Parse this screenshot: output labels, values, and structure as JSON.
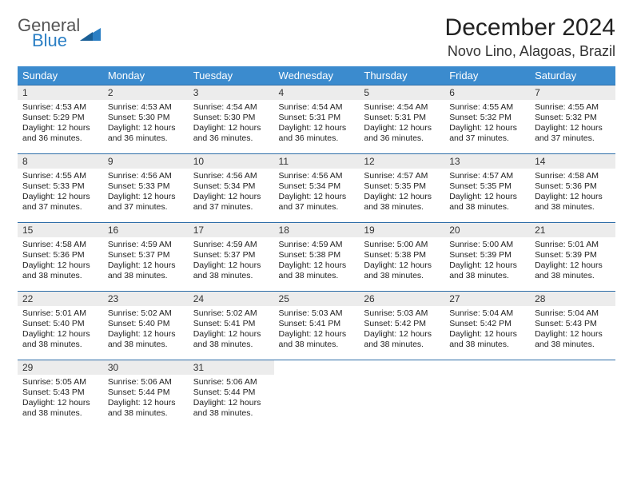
{
  "logo": {
    "line1": "General",
    "line2": "Blue"
  },
  "title": "December 2024",
  "location": "Novo Lino, Alagoas, Brazil",
  "weekdays": [
    "Sunday",
    "Monday",
    "Tuesday",
    "Wednesday",
    "Thursday",
    "Friday",
    "Saturday"
  ],
  "days": [
    {
      "n": "1",
      "sr": "4:53 AM",
      "ss": "5:29 PM",
      "dl": "12 hours and 36 minutes."
    },
    {
      "n": "2",
      "sr": "4:53 AM",
      "ss": "5:30 PM",
      "dl": "12 hours and 36 minutes."
    },
    {
      "n": "3",
      "sr": "4:54 AM",
      "ss": "5:30 PM",
      "dl": "12 hours and 36 minutes."
    },
    {
      "n": "4",
      "sr": "4:54 AM",
      "ss": "5:31 PM",
      "dl": "12 hours and 36 minutes."
    },
    {
      "n": "5",
      "sr": "4:54 AM",
      "ss": "5:31 PM",
      "dl": "12 hours and 36 minutes."
    },
    {
      "n": "6",
      "sr": "4:55 AM",
      "ss": "5:32 PM",
      "dl": "12 hours and 37 minutes."
    },
    {
      "n": "7",
      "sr": "4:55 AM",
      "ss": "5:32 PM",
      "dl": "12 hours and 37 minutes."
    },
    {
      "n": "8",
      "sr": "4:55 AM",
      "ss": "5:33 PM",
      "dl": "12 hours and 37 minutes."
    },
    {
      "n": "9",
      "sr": "4:56 AM",
      "ss": "5:33 PM",
      "dl": "12 hours and 37 minutes."
    },
    {
      "n": "10",
      "sr": "4:56 AM",
      "ss": "5:34 PM",
      "dl": "12 hours and 37 minutes."
    },
    {
      "n": "11",
      "sr": "4:56 AM",
      "ss": "5:34 PM",
      "dl": "12 hours and 37 minutes."
    },
    {
      "n": "12",
      "sr": "4:57 AM",
      "ss": "5:35 PM",
      "dl": "12 hours and 38 minutes."
    },
    {
      "n": "13",
      "sr": "4:57 AM",
      "ss": "5:35 PM",
      "dl": "12 hours and 38 minutes."
    },
    {
      "n": "14",
      "sr": "4:58 AM",
      "ss": "5:36 PM",
      "dl": "12 hours and 38 minutes."
    },
    {
      "n": "15",
      "sr": "4:58 AM",
      "ss": "5:36 PM",
      "dl": "12 hours and 38 minutes."
    },
    {
      "n": "16",
      "sr": "4:59 AM",
      "ss": "5:37 PM",
      "dl": "12 hours and 38 minutes."
    },
    {
      "n": "17",
      "sr": "4:59 AM",
      "ss": "5:37 PM",
      "dl": "12 hours and 38 minutes."
    },
    {
      "n": "18",
      "sr": "4:59 AM",
      "ss": "5:38 PM",
      "dl": "12 hours and 38 minutes."
    },
    {
      "n": "19",
      "sr": "5:00 AM",
      "ss": "5:38 PM",
      "dl": "12 hours and 38 minutes."
    },
    {
      "n": "20",
      "sr": "5:00 AM",
      "ss": "5:39 PM",
      "dl": "12 hours and 38 minutes."
    },
    {
      "n": "21",
      "sr": "5:01 AM",
      "ss": "5:39 PM",
      "dl": "12 hours and 38 minutes."
    },
    {
      "n": "22",
      "sr": "5:01 AM",
      "ss": "5:40 PM",
      "dl": "12 hours and 38 minutes."
    },
    {
      "n": "23",
      "sr": "5:02 AM",
      "ss": "5:40 PM",
      "dl": "12 hours and 38 minutes."
    },
    {
      "n": "24",
      "sr": "5:02 AM",
      "ss": "5:41 PM",
      "dl": "12 hours and 38 minutes."
    },
    {
      "n": "25",
      "sr": "5:03 AM",
      "ss": "5:41 PM",
      "dl": "12 hours and 38 minutes."
    },
    {
      "n": "26",
      "sr": "5:03 AM",
      "ss": "5:42 PM",
      "dl": "12 hours and 38 minutes."
    },
    {
      "n": "27",
      "sr": "5:04 AM",
      "ss": "5:42 PM",
      "dl": "12 hours and 38 minutes."
    },
    {
      "n": "28",
      "sr": "5:04 AM",
      "ss": "5:43 PM",
      "dl": "12 hours and 38 minutes."
    },
    {
      "n": "29",
      "sr": "5:05 AM",
      "ss": "5:43 PM",
      "dl": "12 hours and 38 minutes."
    },
    {
      "n": "30",
      "sr": "5:06 AM",
      "ss": "5:44 PM",
      "dl": "12 hours and 38 minutes."
    },
    {
      "n": "31",
      "sr": "5:06 AM",
      "ss": "5:44 PM",
      "dl": "12 hours and 38 minutes."
    }
  ],
  "labels": {
    "sunrise": "Sunrise: ",
    "sunset": "Sunset: ",
    "daylight": "Daylight: "
  }
}
